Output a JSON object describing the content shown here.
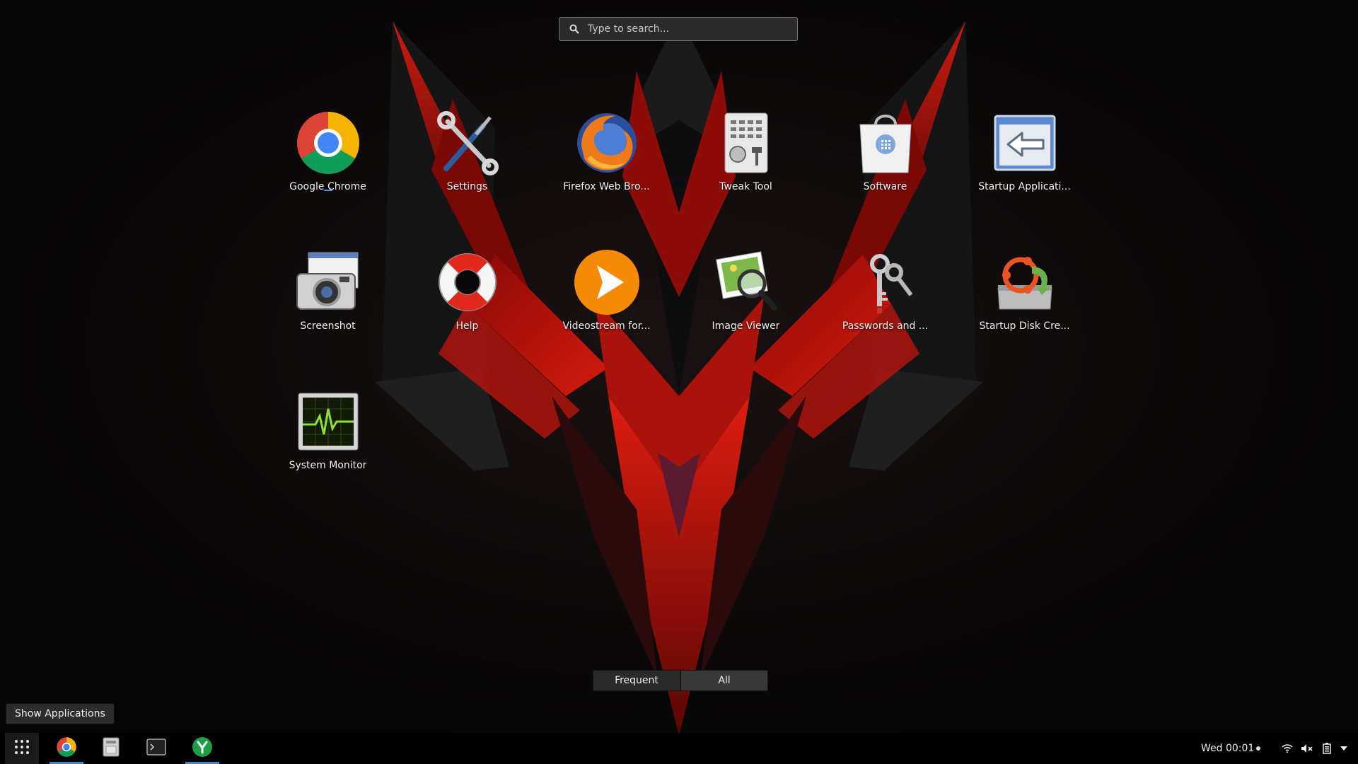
{
  "search": {
    "placeholder": "Type to search..."
  },
  "apps": [
    {
      "label": "Google Chrome",
      "icon": "chrome-icon",
      "running": true
    },
    {
      "label": "Settings",
      "icon": "settings-tools-icon"
    },
    {
      "label": "Firefox Web Bro...",
      "icon": "firefox-icon"
    },
    {
      "label": "Tweak Tool",
      "icon": "tweak-tool-icon"
    },
    {
      "label": "Software",
      "icon": "software-bag-icon"
    },
    {
      "label": "Startup Applicati...",
      "icon": "startup-applications-icon"
    },
    {
      "label": "Screenshot",
      "icon": "camera-icon"
    },
    {
      "label": "Help",
      "icon": "lifebuoy-icon"
    },
    {
      "label": "Videostream for...",
      "icon": "videostream-icon"
    },
    {
      "label": "Image Viewer",
      "icon": "image-viewer-icon"
    },
    {
      "label": "Passwords and ...",
      "icon": "keys-icon"
    },
    {
      "label": "Startup Disk Cre...",
      "icon": "startup-disk-icon"
    },
    {
      "label": "System Monitor",
      "icon": "system-monitor-icon"
    }
  ],
  "view_switcher": {
    "frequent": "Frequent",
    "all": "All",
    "active": "All"
  },
  "tooltip": {
    "text": "Show Applications"
  },
  "taskbar": {
    "items": [
      "apps-grid-icon",
      "chrome-icon",
      "file-manager-icon",
      "terminal-icon",
      "yakyak-icon"
    ],
    "clock": "Wed 00:01",
    "tray": [
      "wifi-icon",
      "volume-muted-icon",
      "battery-icon",
      "menu-arrow-icon"
    ]
  },
  "colors": {
    "accent": "#3f86d3",
    "wallpaper_red": "#c8160e",
    "panel": "#000000"
  }
}
